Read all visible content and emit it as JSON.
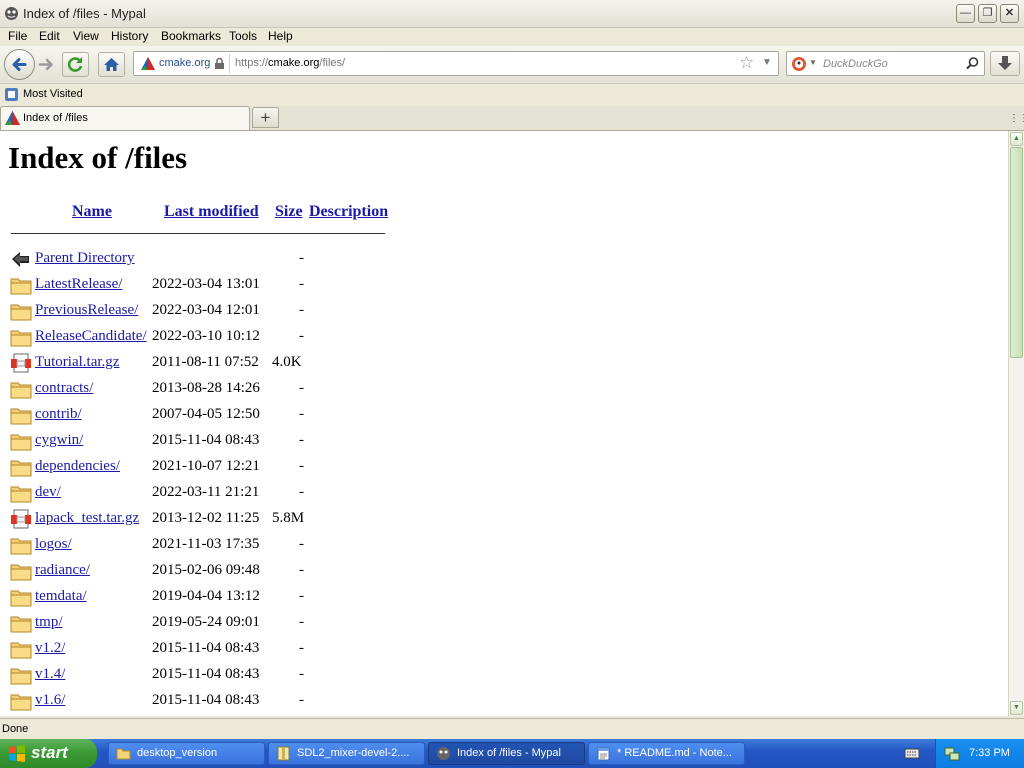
{
  "window": {
    "title": "Index of /files - Mypal"
  },
  "menu": [
    "File",
    "Edit",
    "View",
    "History",
    "Bookmarks",
    "Tools",
    "Help"
  ],
  "navbar": {
    "site_identity": "cmake.org",
    "url_prefix": "https://",
    "url_host": "cmake.org",
    "url_path": "/files/",
    "search_placeholder": "DuckDuckGo"
  },
  "bookmarks": {
    "most_visited": "Most Visited"
  },
  "tabs": [
    {
      "title": "Index of /files"
    }
  ],
  "page": {
    "heading": "Index of /files",
    "columns": {
      "name": "Name",
      "modified": "Last modified",
      "size": "Size",
      "description": "Description"
    },
    "rows": [
      {
        "name": "Parent Directory",
        "date": "",
        "size": "-",
        "type": "parent"
      },
      {
        "name": "LatestRelease/",
        "date": "2022-03-04 13:01",
        "size": "-",
        "type": "folder"
      },
      {
        "name": "PreviousRelease/",
        "date": "2022-03-04 12:01",
        "size": "-",
        "type": "folder"
      },
      {
        "name": "ReleaseCandidate/",
        "date": "2022-03-10 10:12",
        "size": "-",
        "type": "folder"
      },
      {
        "name": "Tutorial.tar.gz",
        "date": "2011-08-11 07:52",
        "size": "4.0K",
        "type": "archive"
      },
      {
        "name": "contracts/",
        "date": "2013-08-28 14:26",
        "size": "-",
        "type": "folder"
      },
      {
        "name": "contrib/",
        "date": "2007-04-05 12:50",
        "size": "-",
        "type": "folder"
      },
      {
        "name": "cygwin/",
        "date": "2015-11-04 08:43",
        "size": "-",
        "type": "folder"
      },
      {
        "name": "dependencies/",
        "date": "2021-10-07 12:21",
        "size": "-",
        "type": "folder"
      },
      {
        "name": "dev/",
        "date": "2022-03-11 21:21",
        "size": "-",
        "type": "folder"
      },
      {
        "name": "lapack_test.tar.gz",
        "date": "2013-12-02 11:25",
        "size": "5.8M",
        "type": "archive"
      },
      {
        "name": "logos/",
        "date": "2021-11-03 17:35",
        "size": "-",
        "type": "folder"
      },
      {
        "name": "radiance/",
        "date": "2015-02-06 09:48",
        "size": "-",
        "type": "folder"
      },
      {
        "name": "temdata/",
        "date": "2019-04-04 13:12",
        "size": "-",
        "type": "folder"
      },
      {
        "name": "tmp/",
        "date": "2019-05-24 09:01",
        "size": "-",
        "type": "folder"
      },
      {
        "name": "v1.2/",
        "date": "2015-11-04 08:43",
        "size": "-",
        "type": "folder"
      },
      {
        "name": "v1.4/",
        "date": "2015-11-04 08:43",
        "size": "-",
        "type": "folder"
      },
      {
        "name": "v1.6/",
        "date": "2015-11-04 08:43",
        "size": "-",
        "type": "folder"
      }
    ]
  },
  "status": {
    "text": "Done"
  },
  "taskbar": {
    "start": "start",
    "tasks": [
      {
        "label": "desktop_version",
        "icon": "folder-icon"
      },
      {
        "label": "SDL2_mixer-devel-2....",
        "icon": "archive-icon"
      },
      {
        "label": "Index of /files - Mypal",
        "icon": "browser-icon"
      },
      {
        "label": "* README.md - Note...",
        "icon": "notepad-icon"
      }
    ],
    "clock": "7:33 PM"
  },
  "colors": {
    "link": "#1a1aa6",
    "taskbar": "#2458c6",
    "start": "#3c9a37"
  }
}
